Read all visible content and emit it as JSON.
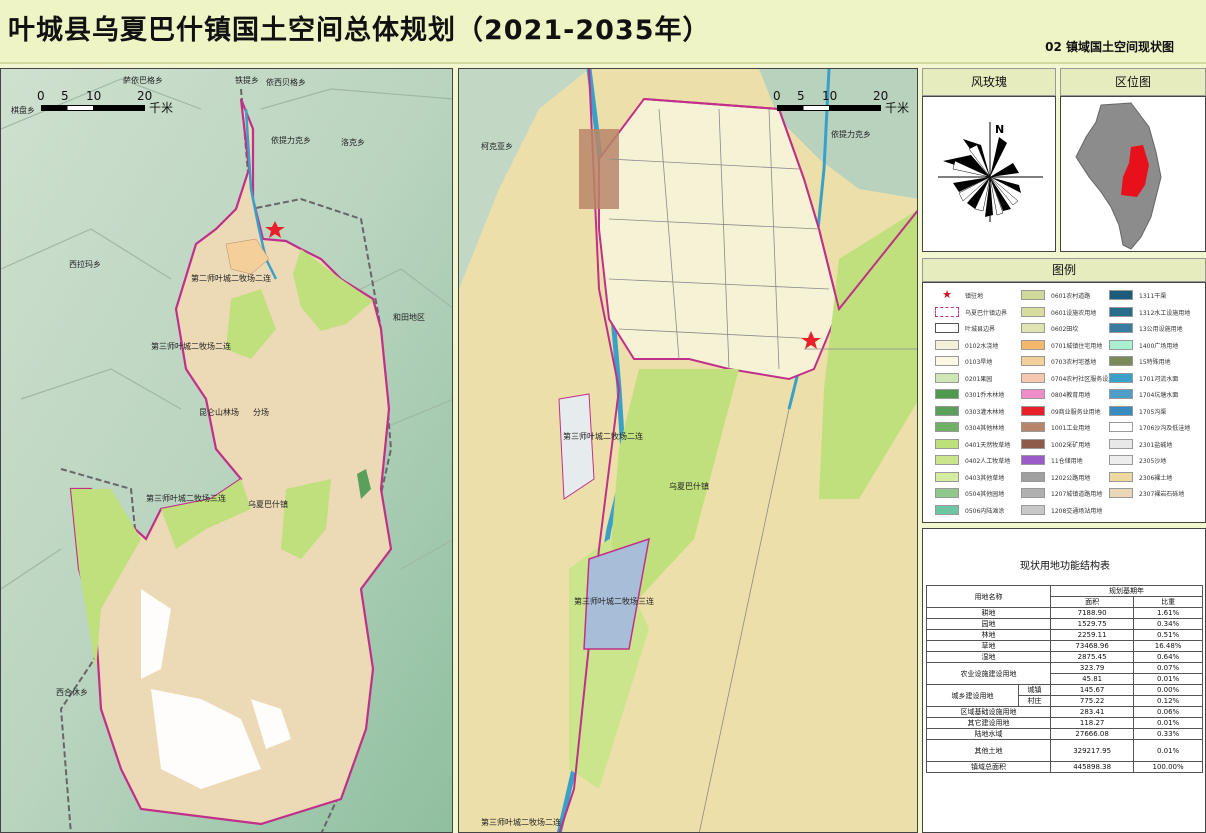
{
  "title": "叶城县乌夏巴什镇国土空间总体规划（2021-2035年）",
  "subtitle": "02  镇域国土空间现状图",
  "left_map": {
    "scale": {
      "ticks": [
        "0",
        "5",
        "10",
        "20"
      ],
      "unit": "千米"
    },
    "places": [
      "萨依巴格乡",
      "铁提乡",
      "依西贝格乡",
      "棋盘乡",
      "依提力克乡",
      "洛克乡",
      "西拉玛乡",
      "第二师叶城二牧场二连",
      "和田地区",
      "第三师叶城二牧场二连",
      "昆仑山林场",
      "分场",
      "第三师叶城二牧场三连",
      "乌夏巴什镇",
      "西合休乡"
    ]
  },
  "right_map": {
    "scale": {
      "ticks": [
        "0",
        "5",
        "10",
        "20"
      ],
      "unit": "千米"
    },
    "places": [
      "柯克亚乡",
      "依提力克乡",
      "第三师叶城二牧场二连",
      "乌夏巴什镇",
      "第三师叶城二牧场三连",
      "第三师叶城二牧场二连"
    ]
  },
  "compass": {
    "title": "风玫瑰",
    "north": "N"
  },
  "location_map": {
    "title": "区位图"
  },
  "legend": {
    "title": "图例",
    "items": [
      {
        "label": "镇驻地",
        "color": "#d01020"
      },
      {
        "label": "乌夏巴什镇边界",
        "color": "#c0308a"
      },
      {
        "label": "叶城县边界",
        "color": "#555555"
      },
      {
        "label": "0102水浇地",
        "color": "#f4f1d8"
      },
      {
        "label": "0103旱地",
        "color": "#fbf8e4"
      },
      {
        "label": "0201果园",
        "color": "#cfe7b4"
      },
      {
        "label": "0301乔木林地",
        "color": "#4d9a4c"
      },
      {
        "label": "0303灌木林地",
        "color": "#5aa05a"
      },
      {
        "label": "0304其他林地",
        "color": "#6fb065"
      },
      {
        "label": "0401天然牧草地",
        "color": "#bde07a"
      },
      {
        "label": "0402人工牧草地",
        "color": "#cbe58c"
      },
      {
        "label": "0403其他草地",
        "color": "#d5eba0"
      },
      {
        "label": "0504其他园地",
        "color": "#8fc88a"
      },
      {
        "label": "0506内陆滩涂",
        "color": "#6dc6a3"
      },
      {
        "label": "0601农村道路",
        "color": "#cfd89a"
      },
      {
        "label": "0601设施农用地",
        "color": "#d9de9e"
      },
      {
        "label": "0602田坎",
        "color": "#dfe3b0"
      },
      {
        "label": "0701城镇住宅用地",
        "color": "#f6b86a"
      },
      {
        "label": "0703农村宅基地",
        "color": "#f3cf9a"
      },
      {
        "label": "0704农村社区服务设施用地",
        "color": "#f7c8b0"
      },
      {
        "label": "0804教育用地",
        "color": "#f08cc8"
      },
      {
        "label": "09商业服务业用地",
        "color": "#e8202a"
      },
      {
        "label": "1001工业用地",
        "color": "#b7866a"
      },
      {
        "label": "1002采矿用地",
        "color": "#8e5a4a"
      },
      {
        "label": "11仓储用地",
        "color": "#9a5cc8"
      },
      {
        "label": "1202公路用地",
        "color": "#a0a0a0"
      },
      {
        "label": "1207城镇道路用地",
        "color": "#b0b0b0"
      },
      {
        "label": "1208交通场站用地",
        "color": "#c8c8c8"
      },
      {
        "label": "1311干渠",
        "color": "#1c5a7a"
      },
      {
        "label": "1312水工设施用地",
        "color": "#2a6c8e"
      },
      {
        "label": "13公用设施用地",
        "color": "#3a7ca0"
      },
      {
        "label": "1400广场用地",
        "color": "#a8f0d0"
      },
      {
        "label": "15特殊用地",
        "color": "#7a8a5a"
      },
      {
        "label": "1701河流水面",
        "color": "#3aa0c8"
      },
      {
        "label": "1704坑塘水面",
        "color": "#4e9ec8"
      },
      {
        "label": "1705沟渠",
        "color": "#3a8cc0"
      },
      {
        "label": "1706沙沟及低洼地",
        "color": "#ffffff"
      },
      {
        "label": "2301盐碱地",
        "color": "#e8e8e8"
      },
      {
        "label": "2305沙地",
        "color": "#ededed"
      },
      {
        "label": "2306裸土地",
        "color": "#ecd9a0"
      },
      {
        "label": "2307裸岩石砾地",
        "color": "#e8d8b8"
      }
    ]
  },
  "land_table": {
    "title": "现状用地功能结构表",
    "header": {
      "name": "用地名称",
      "group": "规划基期年",
      "area": "面积",
      "ratio": "比重"
    },
    "rows": [
      {
        "name": "耕地",
        "area": "7188.90",
        "ratio": "1.61%"
      },
      {
        "name": "园地",
        "area": "1529.75",
        "ratio": "0.34%"
      },
      {
        "name": "林地",
        "area": "2259.11",
        "ratio": "0.51%"
      },
      {
        "name": "草地",
        "area": "73468.96",
        "ratio": "16.48%"
      },
      {
        "name": "湿地",
        "area": "2875.45",
        "ratio": "0.64%"
      },
      {
        "name": "农业设施建设用地",
        "area": "323.79",
        "ratio": "0.07%",
        "area2": "45.81",
        "ratio2": "0.01%"
      },
      {
        "name": "城乡建设用地",
        "sub": "城镇",
        "area": "145.67",
        "ratio": "0.00%"
      },
      {
        "sub": "村庄",
        "area": "775.22",
        "ratio": "0.12%"
      },
      {
        "name": "区域基础设施用地",
        "area": "283.41",
        "ratio": "0.06%"
      },
      {
        "name": "其它建设用地",
        "area": "118.27",
        "ratio": "0.01%"
      },
      {
        "name": "陆地水域",
        "area": "27666.08",
        "ratio": "0.33%"
      },
      {
        "name": "其他土地",
        "area": "329217.95",
        "ratio": "0.01%"
      },
      {
        "name": "镇域总面积",
        "area": "445898.38",
        "ratio": "100.00%"
      }
    ]
  }
}
